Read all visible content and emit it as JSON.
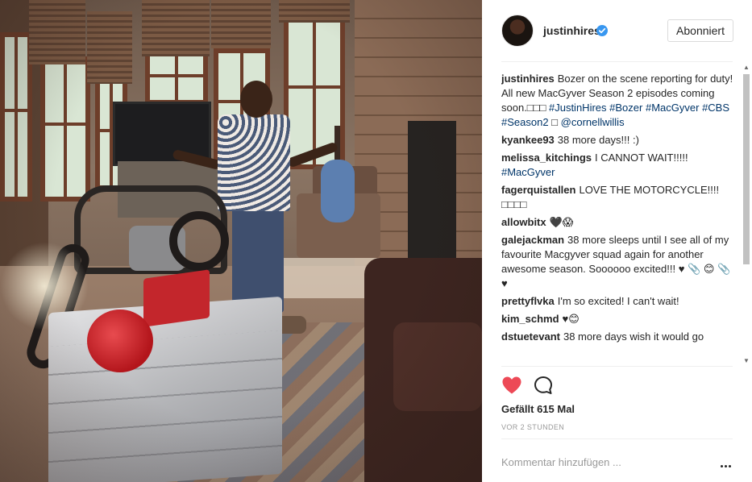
{
  "post": {
    "username": "justinhires",
    "follow_label": "Abonniert",
    "likes": "Gefällt 615 Mal",
    "timestamp": "VOR 2 STUNDEN",
    "comment_placeholder": "Kommentar hinzufügen ...",
    "icons": {
      "verified": "verified-badge-icon",
      "like": "heart-icon",
      "comment": "speech-bubble-icon",
      "more": "more-options-icon"
    },
    "colors": {
      "like_red": "#ed4956",
      "verified_blue": "#3897f0",
      "hashtag_blue": "#003569"
    }
  },
  "comments": [
    {
      "user": "justinhires",
      "parts": [
        {
          "t": "Bozer on the scene reporting for duty! All new MacGyver Season 2 episodes coming soon.□□□ "
        },
        {
          "t": "#JustinHires",
          "tag": true
        },
        {
          "t": " "
        },
        {
          "t": "#Bozer",
          "tag": true
        },
        {
          "t": " "
        },
        {
          "t": "#MacGyver",
          "tag": true
        },
        {
          "t": " "
        },
        {
          "t": "#CBS",
          "tag": true
        },
        {
          "t": " "
        },
        {
          "t": "#Season2",
          "tag": true
        },
        {
          "t": " □ "
        },
        {
          "t": "@cornellwillis",
          "tag": true
        }
      ]
    },
    {
      "user": "kyankee93",
      "parts": [
        {
          "t": "38 more days!!! :)"
        }
      ]
    },
    {
      "user": "melissa_kitchings",
      "parts": [
        {
          "t": "I CANNOT WAIT!!!!! "
        },
        {
          "t": "#MacGyver",
          "tag": true
        }
      ]
    },
    {
      "user": "fagerquistallen",
      "parts": [
        {
          "t": "LOVE THE MOTORCYCLE!!!! □□□□"
        }
      ]
    },
    {
      "user": "allowbitx",
      "parts": [
        {
          "t": "🖤😱"
        }
      ]
    },
    {
      "user": "galejackman",
      "parts": [
        {
          "t": "38 more sleeps until I see all of my favourite Macgyver squad again for another awesome season. Soooooo excited!!! ♥ 📎 😊 📎 ♥"
        }
      ]
    },
    {
      "user": "prettyflvka",
      "parts": [
        {
          "t": "I'm so excited! I can't wait!"
        }
      ]
    },
    {
      "user": "kim_schmd",
      "parts": [
        {
          "t": "♥😊"
        }
      ]
    },
    {
      "user": "dstuetevant",
      "parts": [
        {
          "t": "38 more days wish it would go"
        }
      ]
    }
  ]
}
